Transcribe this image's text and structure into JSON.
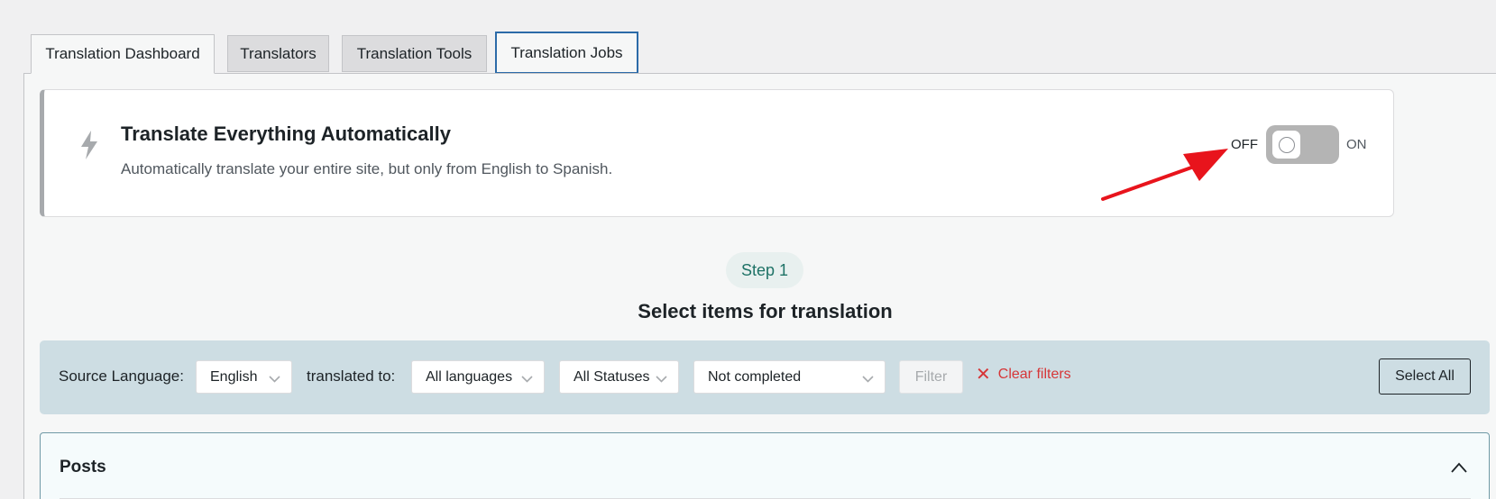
{
  "tabs": [
    {
      "label": "Translation Dashboard",
      "state": "active"
    },
    {
      "label": "Translators",
      "state": "inactive"
    },
    {
      "label": "Translation Tools",
      "state": "inactive"
    },
    {
      "label": "Translation Jobs",
      "state": "focused"
    }
  ],
  "auto_translate": {
    "icon": "bolt-icon",
    "title": "Translate Everything Automatically",
    "description": "Automatically translate your entire site, but only from English to Spanish.",
    "off_label": "OFF",
    "on_label": "ON",
    "toggle_state": "off"
  },
  "step": {
    "badge": "Step 1",
    "heading": "Select items for translation"
  },
  "filters": {
    "source_language_label": "Source Language:",
    "source_language_value": "English",
    "translated_to_label": "translated to:",
    "target_language_value": "All languages",
    "status_value": "All Statuses",
    "completion_value": "Not completed",
    "filter_button": "Filter",
    "clear_filters": "Clear filters",
    "select_all": "Select All"
  },
  "posts_section": {
    "title": "Posts",
    "expanded": true
  },
  "colors": {
    "accent": "#2c6ba8",
    "step_green": "#1e7266",
    "clear_red": "#d63638",
    "filter_bar_bg": "#cddde3",
    "annotation_arrow": "#e8141c"
  }
}
